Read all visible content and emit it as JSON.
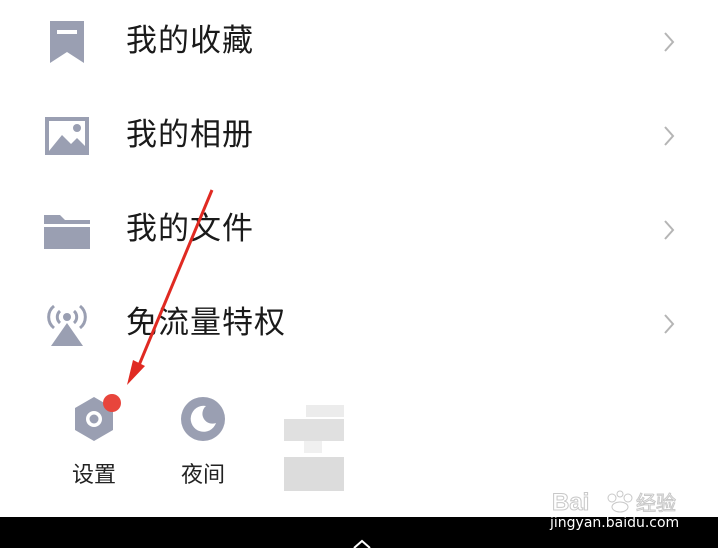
{
  "menu": {
    "items": [
      {
        "label": "我的收藏",
        "icon": "bookmark-icon"
      },
      {
        "label": "我的相册",
        "icon": "image-icon"
      },
      {
        "label": "我的文件",
        "icon": "folder-icon"
      },
      {
        "label": "免流量特权",
        "icon": "signal-tower-icon"
      }
    ]
  },
  "bottom_bar": {
    "settings_label": "设置",
    "night_label": "夜间",
    "settings_badge": true
  },
  "watermark": {
    "brand": "Bai 经验",
    "url": "jingyan.baidu.com"
  },
  "colors": {
    "icon_gray": "#9a9fb2",
    "badge_red": "#e8453c",
    "arrow_red": "#e02a22",
    "text": "#1a1a1a",
    "chevron": "#b5b5b5"
  }
}
